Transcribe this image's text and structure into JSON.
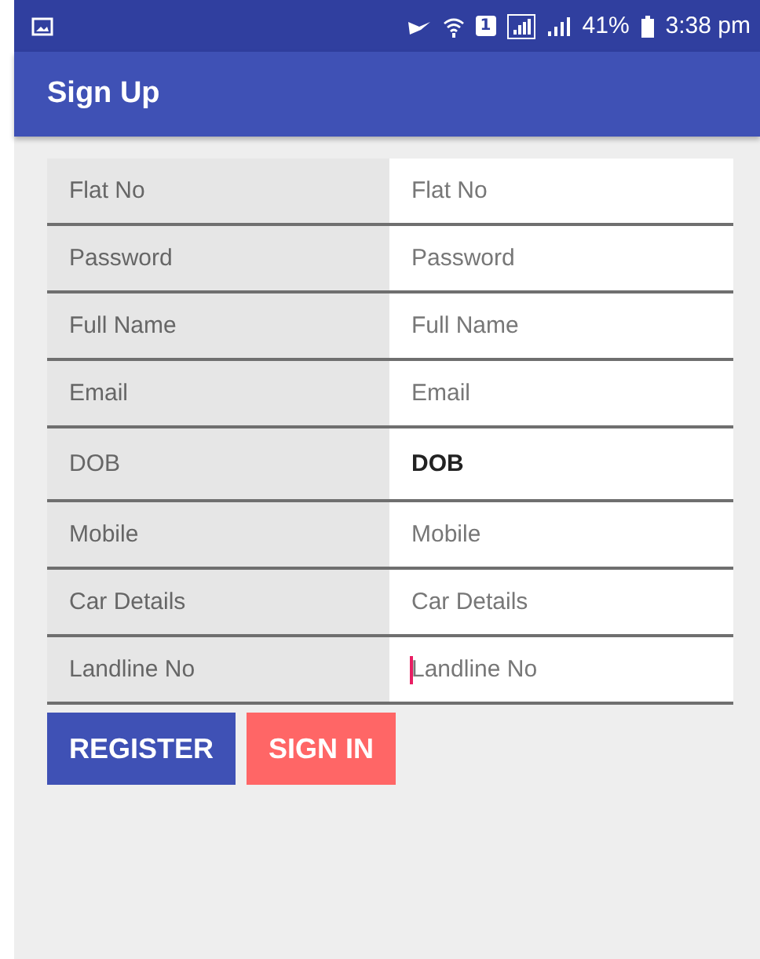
{
  "status_bar": {
    "battery": "41%",
    "time": "3:38 pm",
    "sim": "1"
  },
  "app_bar": {
    "title": "Sign Up"
  },
  "fields": [
    {
      "label": "Flat No",
      "placeholder": "Flat No",
      "focused": false
    },
    {
      "label": "Password",
      "placeholder": "Password",
      "focused": false
    },
    {
      "label": "Full Name",
      "placeholder": "Full Name",
      "focused": false
    },
    {
      "label": "Email",
      "placeholder": "Email",
      "focused": false
    },
    {
      "label": "DOB",
      "value": "DOB",
      "focused": false
    },
    {
      "label": "Mobile",
      "placeholder": "Mobile",
      "focused": false
    },
    {
      "label": "Car Details",
      "placeholder": "Car Details",
      "focused": false
    },
    {
      "label": "Landline No",
      "placeholder": "Landline No",
      "focused": true
    }
  ],
  "buttons": [
    {
      "label": "REGISTER",
      "kind": "primary"
    },
    {
      "label": "SIGN IN",
      "kind": "secondary"
    }
  ]
}
